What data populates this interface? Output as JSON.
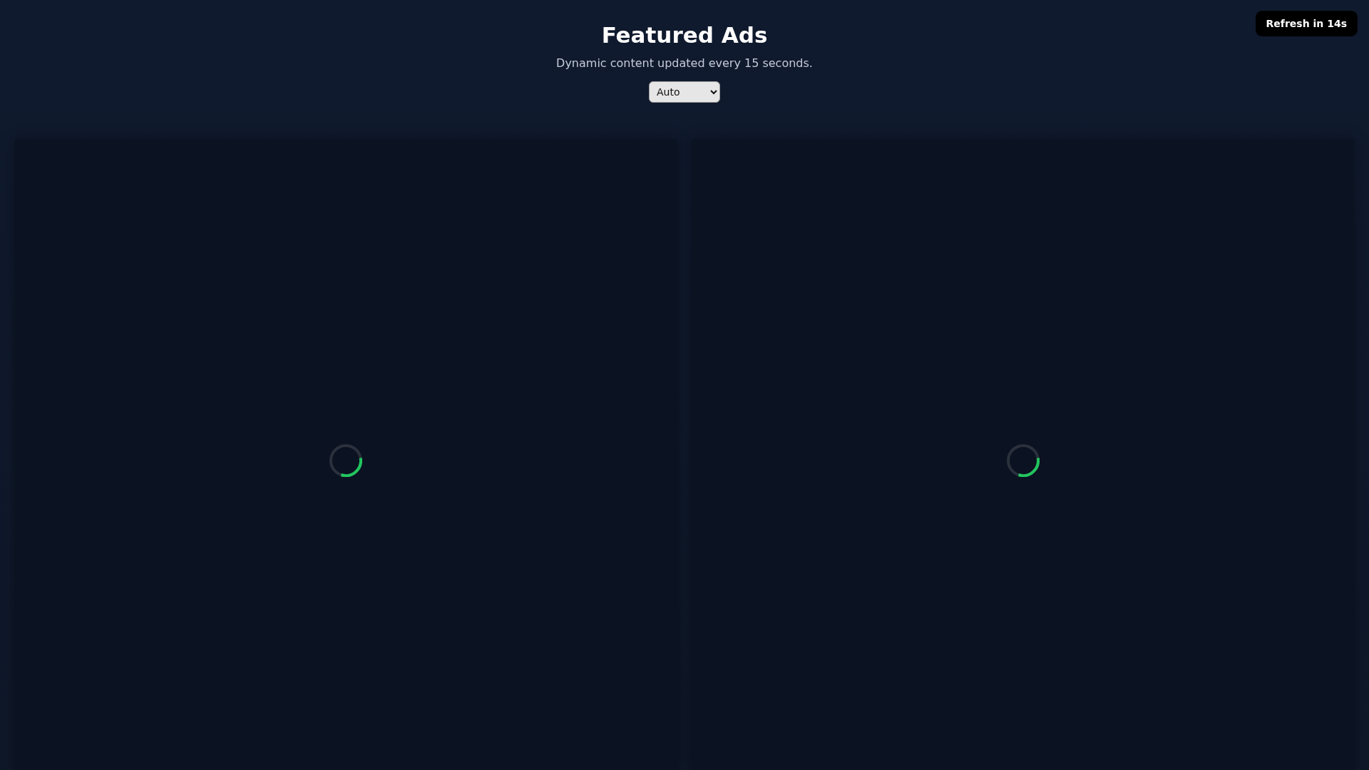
{
  "header": {
    "title": "Featured Ads",
    "subtitle": "Dynamic content updated every 15 seconds.",
    "mode_select": {
      "value": "Auto"
    }
  },
  "refresh_badge": {
    "label": "Refresh in 14s"
  },
  "ad_slots": [
    {
      "loading": true
    },
    {
      "loading": true
    }
  ]
}
